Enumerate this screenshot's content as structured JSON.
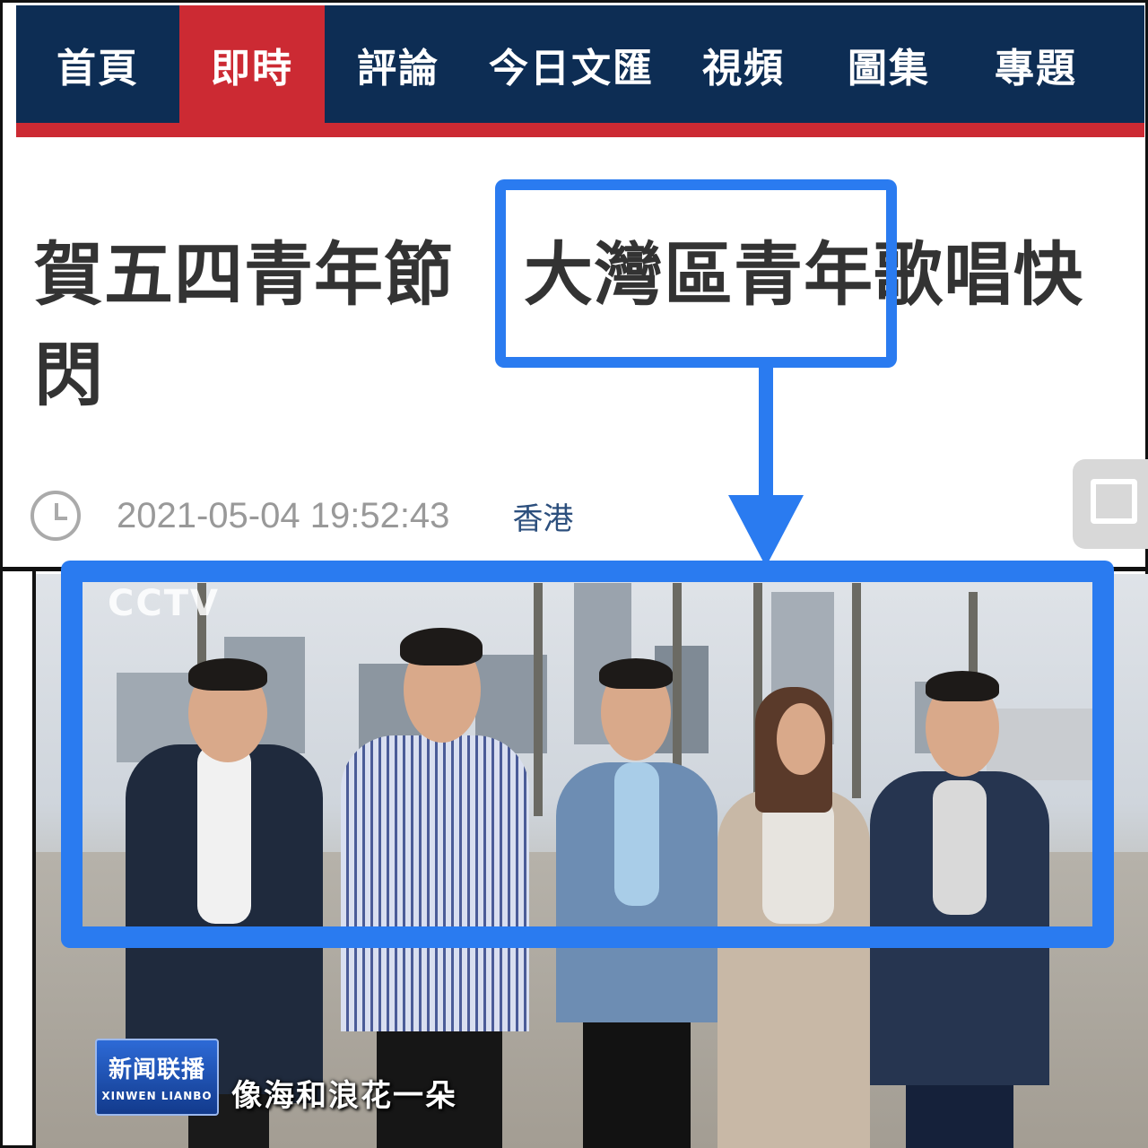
{
  "nav": {
    "items": [
      "首頁",
      "即時",
      "評論",
      "今日文匯",
      "視頻",
      "圖集",
      "專題"
    ],
    "active": "即時"
  },
  "article": {
    "headline": "賀五四青年節　大灣區青年歌唱快閃",
    "highlighted_phrase": "大灣區青年",
    "datetime": "2021-05-04 19:52:43",
    "region": "香港"
  },
  "video": {
    "channel_watermark": "CCTV",
    "program_logo_cn": "新闻联播",
    "program_logo_en": "XINWEN LIANBO",
    "subtitle": "像海和浪花一朵"
  },
  "colors": {
    "nav_bg": "#0d2d54",
    "nav_active": "#cc2a33",
    "annotation_blue": "#2a7bf0",
    "region_link": "#2c4f7d"
  },
  "icons": [
    "clock-icon",
    "comment-icon",
    "arrow-down-icon"
  ]
}
